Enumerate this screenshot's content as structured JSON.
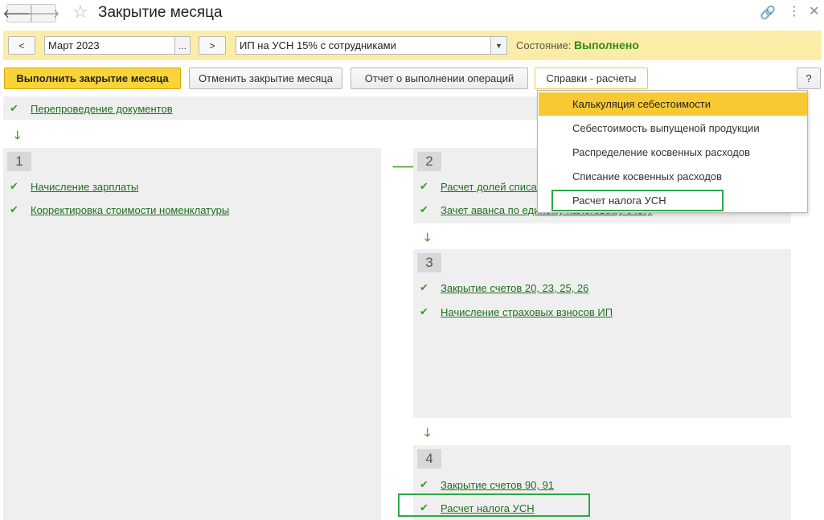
{
  "window": {
    "title": "Закрытие месяца",
    "back_icon": "arrow-left-icon",
    "forward_icon": "arrow-right-icon",
    "favorite_icon": "star-icon"
  },
  "filter": {
    "prev_label": "<",
    "period_value": "Март 2023",
    "period_select_label": "...",
    "next_label": ">",
    "organization_value": "ИП на УСН 15% с сотрудниками",
    "state_label": "Состояние:",
    "state_value": "Выполнено"
  },
  "toolbar": {
    "execute_label": "Выполнить закрытие месяца",
    "cancel_label": "Отменить закрытие месяца",
    "report_label": "Отчет о выполнении операций",
    "references_label": "Справки - расчеты",
    "help_label": "?"
  },
  "dropdown": {
    "items": [
      {
        "label": "Калькуляция себестоимости",
        "selected": true
      },
      {
        "label": "Себестоимость выпущеной продукции"
      },
      {
        "label": "Распределение косвенных расходов"
      },
      {
        "label": "Списание косвенных расходов"
      },
      {
        "label": "Расчет налога УСН",
        "highlighted": true
      }
    ]
  },
  "pre_stage": {
    "ops": [
      {
        "label": "Перепроведение документов"
      }
    ]
  },
  "stages": [
    {
      "number": "1",
      "ops": [
        {
          "label": "Начисление зарплаты"
        },
        {
          "label": "Корректировка стоимости номенклатуры"
        }
      ]
    },
    {
      "number": "2",
      "ops": [
        {
          "label": "Расчет долей списания"
        },
        {
          "label": "Зачет аванса по единому налоговому счету"
        }
      ]
    },
    {
      "number": "3",
      "ops": [
        {
          "label": "Закрытие счетов 20, 23, 25, 26"
        },
        {
          "label": "Начисление страховых взносов ИП"
        }
      ]
    },
    {
      "number": "4",
      "ops": [
        {
          "label": "Закрытие счетов 90, 91"
        },
        {
          "label": "Расчет налога УСН",
          "highlighted": true
        }
      ]
    }
  ],
  "colors": {
    "accent": "#f8d33a",
    "filter_bg": "#fbeda7",
    "status_ok": "#2e8b1f",
    "highlight_frame": "#2ba84a"
  }
}
